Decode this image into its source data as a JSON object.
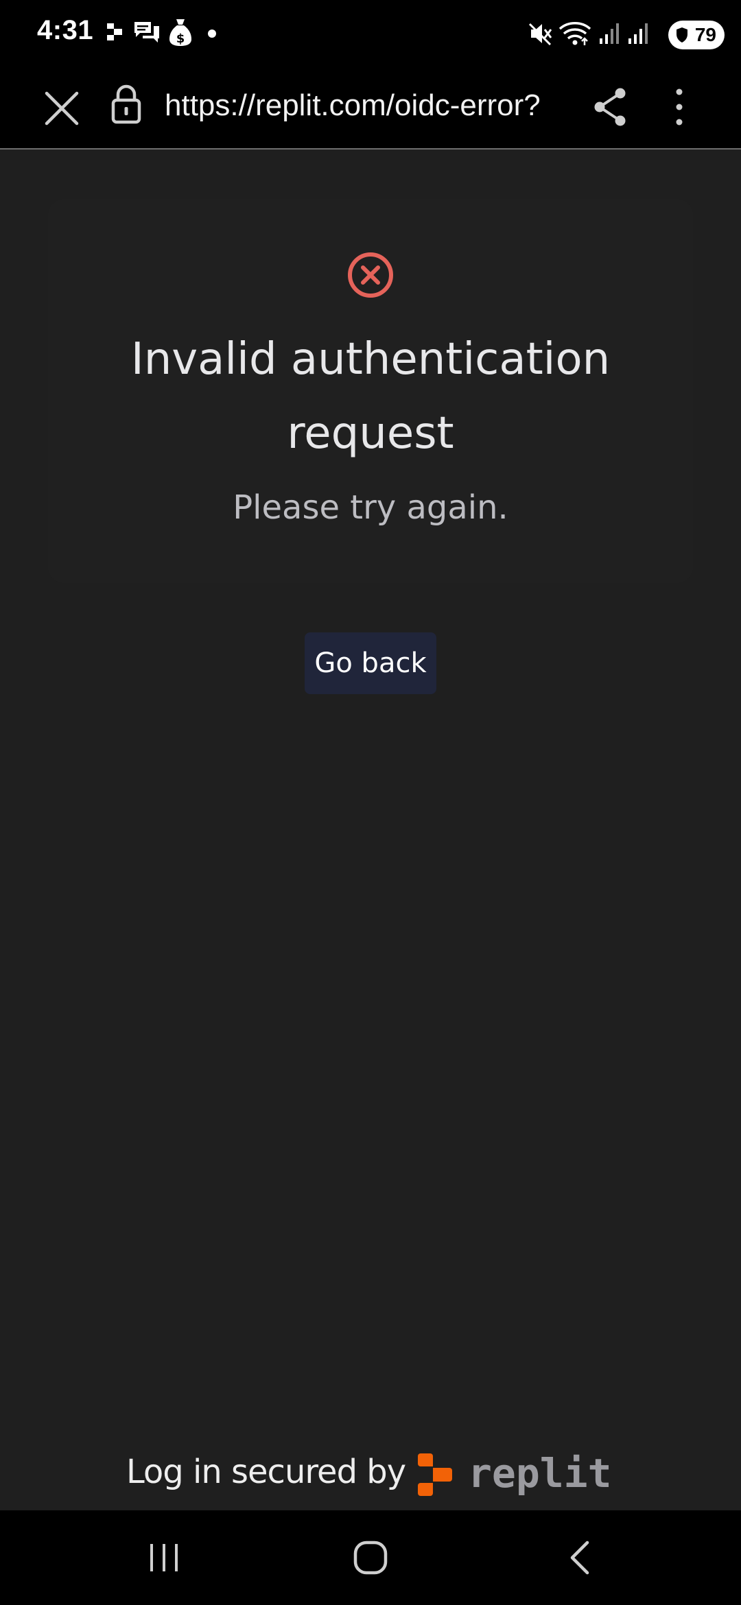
{
  "status_bar": {
    "time": "4:31",
    "battery_level": "79",
    "icons": [
      "replit-app-icon",
      "chat-icon",
      "money-bag-icon",
      "dot-icon",
      "mute-icon",
      "wifi-icon",
      "signal-icon",
      "signal-icon",
      "battery-icon"
    ]
  },
  "browser": {
    "url": "https://replit.com/oidc-error?",
    "icons": [
      "close-icon",
      "lock-icon",
      "share-icon",
      "more-vertical-icon"
    ]
  },
  "page": {
    "title": "Invalid authentication request",
    "subtitle": "Please try again.",
    "go_back_label": "Go back",
    "error_icon": "x-circle-icon",
    "error_color": "#e5635a"
  },
  "footer": {
    "text": "Log in secured by",
    "brand": "replit",
    "brand_color": "#f26207"
  },
  "nav_bar": {
    "icons": [
      "recent-apps-icon",
      "home-icon",
      "back-icon"
    ]
  }
}
